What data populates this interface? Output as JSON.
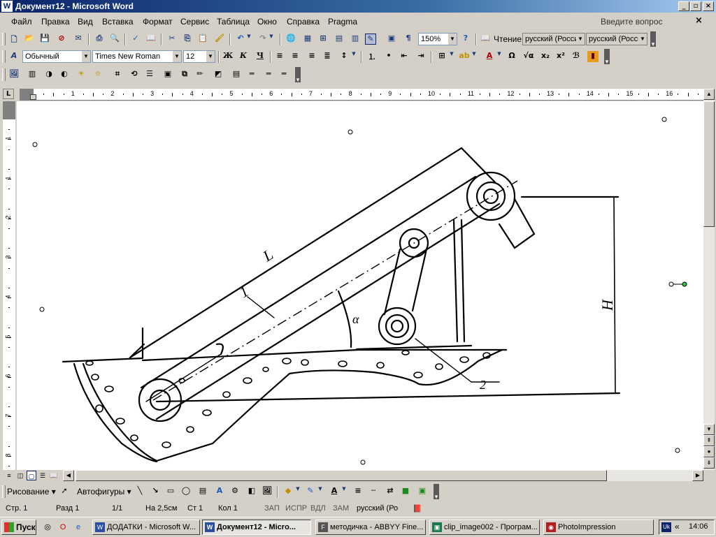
{
  "window": {
    "title": "Документ12 - Microsoft Word",
    "icon": "word-doc-icon"
  },
  "menu": {
    "items": [
      "Файл",
      "Правка",
      "Вид",
      "Вставка",
      "Формат",
      "Сервис",
      "Таблица",
      "Окно",
      "Справка",
      "Pragma"
    ],
    "help_box": "Введите вопрос"
  },
  "standard_toolbar": {
    "zoom": "150%",
    "read_label": "Чтение",
    "lang1": "русский (Росси",
    "lang2": "русский (Росси"
  },
  "format_toolbar": {
    "style": "Обычный",
    "font": "Times New Roman",
    "size": "12",
    "bold": "Ж",
    "italic": "К",
    "underline": "Ч"
  },
  "ruler": {
    "h_numbers": [
      "1",
      "1",
      "2",
      "3",
      "4",
      "5",
      "6",
      "7",
      "8",
      "9",
      "10",
      "11",
      "12",
      "13",
      "14",
      "15",
      "16"
    ],
    "v_numbers": [
      "1",
      "1",
      "2",
      "3",
      "4",
      "5",
      "6",
      "7",
      "8"
    ]
  },
  "drawing": {
    "labels": {
      "L": "L",
      "one": "1",
      "alpha": "α",
      "H": "H",
      "two": "2"
    }
  },
  "drawing_toolbar": {
    "draw": "Рисование",
    "autoshapes": "Автофигуры"
  },
  "status": {
    "page": "Стр.  1",
    "section": "Разд  1",
    "pages": "1/1",
    "at": "На  2,5см",
    "line": "Ст  1",
    "col": "Кол  1",
    "rec": "ЗАП",
    "trk": "ИСПР",
    "ext": "ВДЛ",
    "ovr": "ЗАМ",
    "lang": "русский (Ро"
  },
  "taskbar": {
    "start": "Пуск",
    "tasks": [
      "ДОДАТКИ - Microsoft W...",
      "Документ12 - Micro...",
      "методичка - ABBYY Fine...",
      "clip_image002 - Програм...",
      "PhotoImpression"
    ],
    "lang": "Uk",
    "time": "14:06"
  }
}
